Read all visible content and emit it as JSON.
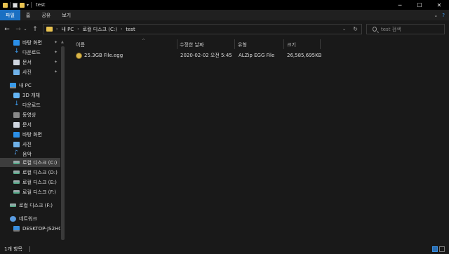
{
  "window": {
    "title": "test",
    "minimize": "─",
    "maximize": "☐",
    "close": "✕"
  },
  "ribbon": {
    "tabs": [
      {
        "label": "파일",
        "active": true
      },
      {
        "label": "홈",
        "active": false
      },
      {
        "label": "공유",
        "active": false
      },
      {
        "label": "보기",
        "active": false
      }
    ],
    "collapse": "⌄",
    "help": "?"
  },
  "nav": {
    "back": "←",
    "forward": "→",
    "recent": "⌄",
    "up": "↑",
    "breadcrumb": [
      "내 PC",
      "로컬 디스크 (C:)",
      "test"
    ],
    "dropdown": "⌄",
    "refresh": "↻",
    "search_placeholder": "test 검색"
  },
  "sidebar": {
    "quick_access": [
      {
        "label": "바탕 화면",
        "icon": "desktop-icon",
        "pinned": true
      },
      {
        "label": "다운로드",
        "icon": "download-icon",
        "pinned": true
      },
      {
        "label": "문서",
        "icon": "documents-icon",
        "pinned": true
      },
      {
        "label": "사진",
        "icon": "pictures-icon",
        "pinned": true
      }
    ],
    "this_pc": {
      "label": "내 PC",
      "icon": "pc-icon"
    },
    "pc_items": [
      {
        "label": "3D 개체",
        "icon": "3d-objects-icon"
      },
      {
        "label": "다운로드",
        "icon": "download-icon"
      },
      {
        "label": "동영상",
        "icon": "videos-icon"
      },
      {
        "label": "문서",
        "icon": "documents-icon"
      },
      {
        "label": "바탕 화면",
        "icon": "desktop-icon"
      },
      {
        "label": "사진",
        "icon": "pictures-icon"
      },
      {
        "label": "음악",
        "icon": "music-icon"
      },
      {
        "label": "로컬 디스크 (C:)",
        "icon": "drive-icon",
        "selected": true
      },
      {
        "label": "로컬 디스크 (D:)",
        "icon": "drive-icon"
      },
      {
        "label": "로컬 디스크 (E:)",
        "icon": "drive-icon"
      },
      {
        "label": "로컬 디스크 (F:)",
        "icon": "drive-icon"
      }
    ],
    "drive_f": {
      "label": "로컬 디스크 (F:)",
      "icon": "drive-icon"
    },
    "network": {
      "label": "네트워크",
      "icon": "network-icon"
    },
    "desktop_pc": {
      "label": "DESKTOP-JS2HO",
      "icon": "computer-icon"
    },
    "pin_glyph": "📌"
  },
  "columns": {
    "name": "이름",
    "date": "수정한 날짜",
    "type": "유형",
    "size": "크기",
    "sort_indicator": "^"
  },
  "files": [
    {
      "name": "25.3GB File.egg",
      "date": "2020-02-02 오전 5:45",
      "type": "ALZip EGG File",
      "size": "26,585,695KB"
    }
  ],
  "status": {
    "count": "1개 항목"
  }
}
